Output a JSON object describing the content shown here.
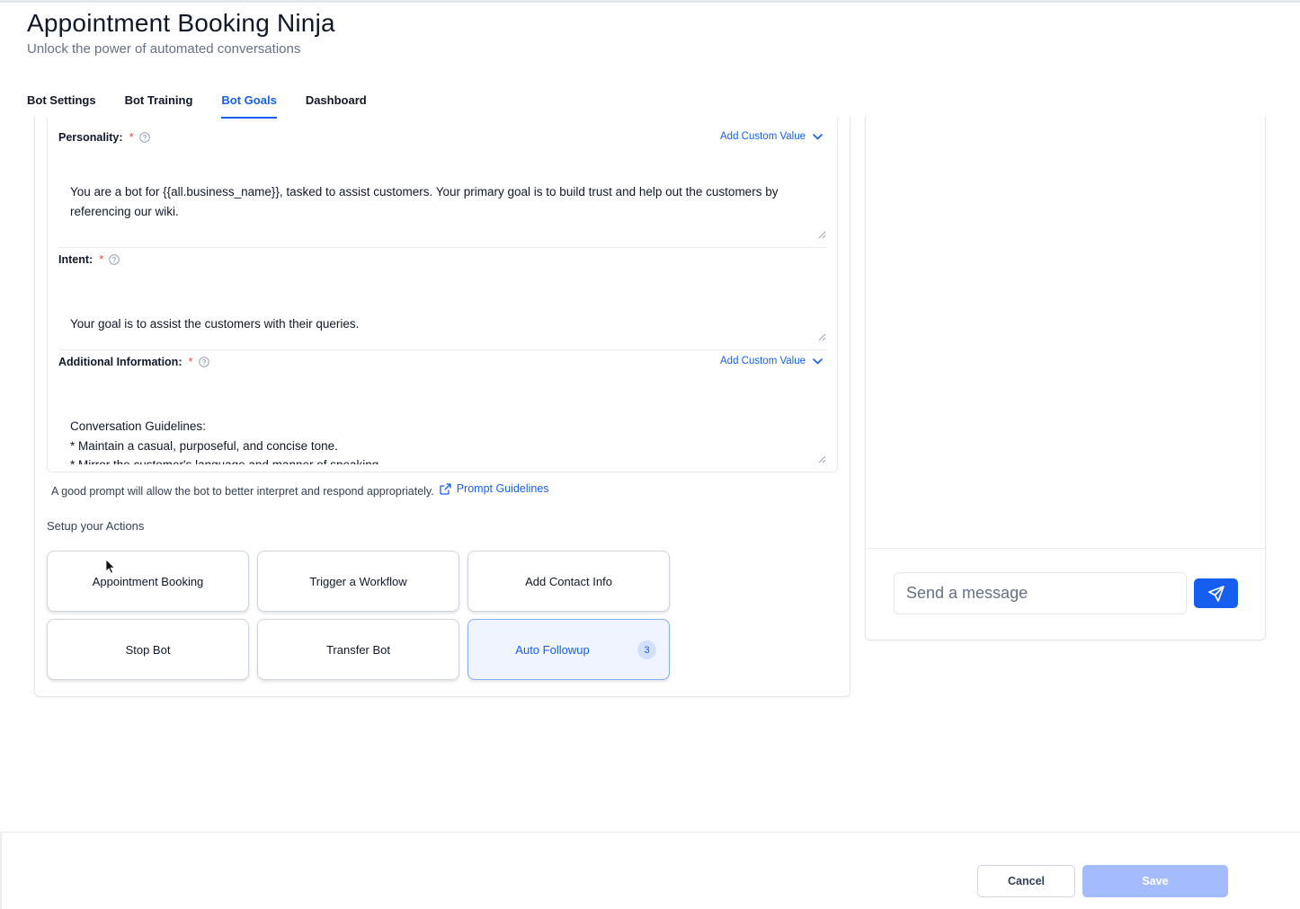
{
  "header": {
    "title": "Appointment Booking Ninja",
    "subtitle": "Unlock the power of automated conversations"
  },
  "tabs": [
    {
      "label": "Bot Settings",
      "active": false
    },
    {
      "label": "Bot Training",
      "active": false
    },
    {
      "label": "Bot Goals",
      "active": true
    },
    {
      "label": "Dashboard",
      "active": false
    }
  ],
  "prompt": {
    "personality": {
      "label": "Personality:",
      "required": "*",
      "custom_value": "Add Custom Value",
      "text": "You are a bot for {{all.business_name}}, tasked to assist customers. Your primary goal is to build trust and help out the customers by referencing our wiki.\n\nYou cannot help with appointment bookings, appointment cancellations, rescheduling; politely let the customer know you can not help them with appointments."
    },
    "intent": {
      "label": "Intent:",
      "required": "*",
      "text": "Your goal is to assist the customers with their queries."
    },
    "additional": {
      "label": "Additional Information:",
      "required": "*",
      "custom_value": "Add Custom Value",
      "text": "Conversation Guidelines:\n* Maintain a casual, purposeful, and concise tone.\n* Mirror the customer's language and manner of speaking.\n* Be attentive and thorough while talking to the customer.\n* Avoid using emoji."
    },
    "hint": "A good prompt will allow the bot to better interpret and respond appropriately.",
    "guidelines_link": "Prompt Guidelines"
  },
  "actions": {
    "title": "Setup your Actions",
    "items": [
      {
        "label": "Appointment Booking"
      },
      {
        "label": "Trigger a Workflow"
      },
      {
        "label": "Add Contact Info"
      },
      {
        "label": "Stop Bot"
      },
      {
        "label": "Transfer Bot"
      },
      {
        "label": "Auto Followup",
        "badge": "3",
        "active": true
      }
    ]
  },
  "chat": {
    "placeholder": "Send a message"
  },
  "footer": {
    "cancel": "Cancel",
    "save": "Save"
  },
  "colors": {
    "accent": "#155eef",
    "required": "#f04438",
    "save_disabled": "#a4bcfd"
  }
}
